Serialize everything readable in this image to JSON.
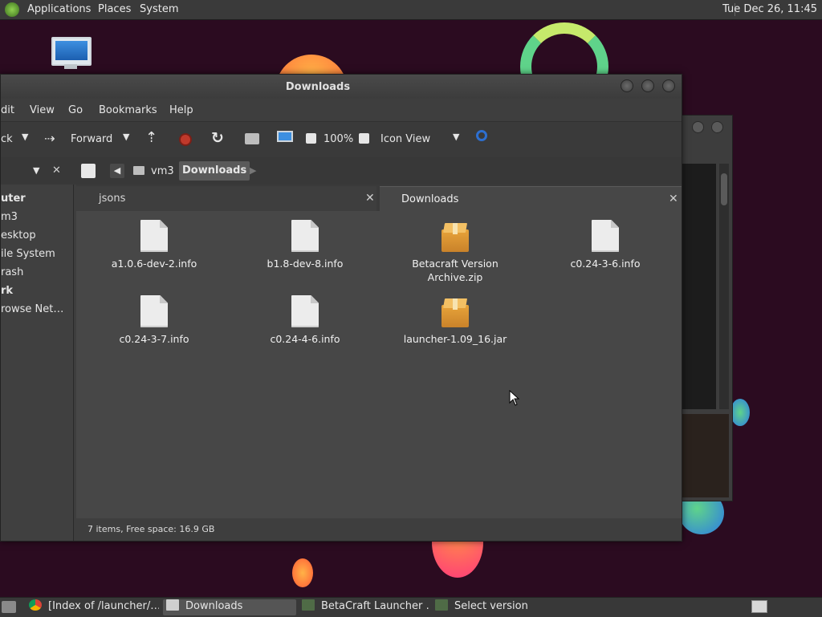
{
  "top_panel": {
    "menu": [
      "Applications",
      "Places",
      "System"
    ],
    "clock": "Tue Dec 26, 11:45"
  },
  "window": {
    "title": "Downloads",
    "menubar": [
      "dit",
      "View",
      "Go",
      "Bookmarks",
      "Help"
    ],
    "toolbar": {
      "back_label": "ck",
      "forward_label": "Forward",
      "zoom": "100%",
      "view_mode": "Icon View"
    },
    "path": [
      "vm3",
      "Downloads"
    ],
    "sidebar": [
      {
        "label": "uter",
        "bold": true
      },
      {
        "label": "m3",
        "bold": false
      },
      {
        "label": "esktop",
        "bold": false
      },
      {
        "label": "ile System",
        "bold": false
      },
      {
        "label": "rash",
        "bold": false
      },
      {
        "label": "rk",
        "bold": true
      },
      {
        "label": "rowse Net…",
        "bold": false
      }
    ],
    "tabs": [
      {
        "label": "jsons",
        "active": false
      },
      {
        "label": "Downloads",
        "active": true
      }
    ],
    "files": [
      {
        "name": "a1.0.6-dev-2.info",
        "type": "document"
      },
      {
        "name": "b1.8-dev-8.info",
        "type": "document"
      },
      {
        "name": "Betacraft Version Archive.zip",
        "type": "archive"
      },
      {
        "name": "c0.24-3-6.info",
        "type": "document"
      },
      {
        "name": "c0.24-3-7.info",
        "type": "document"
      },
      {
        "name": "c0.24-4-6.info",
        "type": "document"
      },
      {
        "name": "launcher-1.09_16.jar",
        "type": "archive"
      }
    ],
    "status": "7 items, Free space: 16.9 GB"
  },
  "taskbar": [
    {
      "label": "[Index of /launcher/…",
      "icon": "chrome-icon"
    },
    {
      "label": "Downloads",
      "icon": "folder-icon",
      "active": true
    },
    {
      "label": "BetaCraft Launcher …",
      "icon": "java-app-icon"
    },
    {
      "label": "Select version",
      "icon": "java-app-icon"
    }
  ],
  "colors": {
    "desktop": "#2b0b20",
    "window_bg": "#3e3e3e",
    "content_bg": "#474747",
    "accent_blue": "#3a7bd5"
  }
}
